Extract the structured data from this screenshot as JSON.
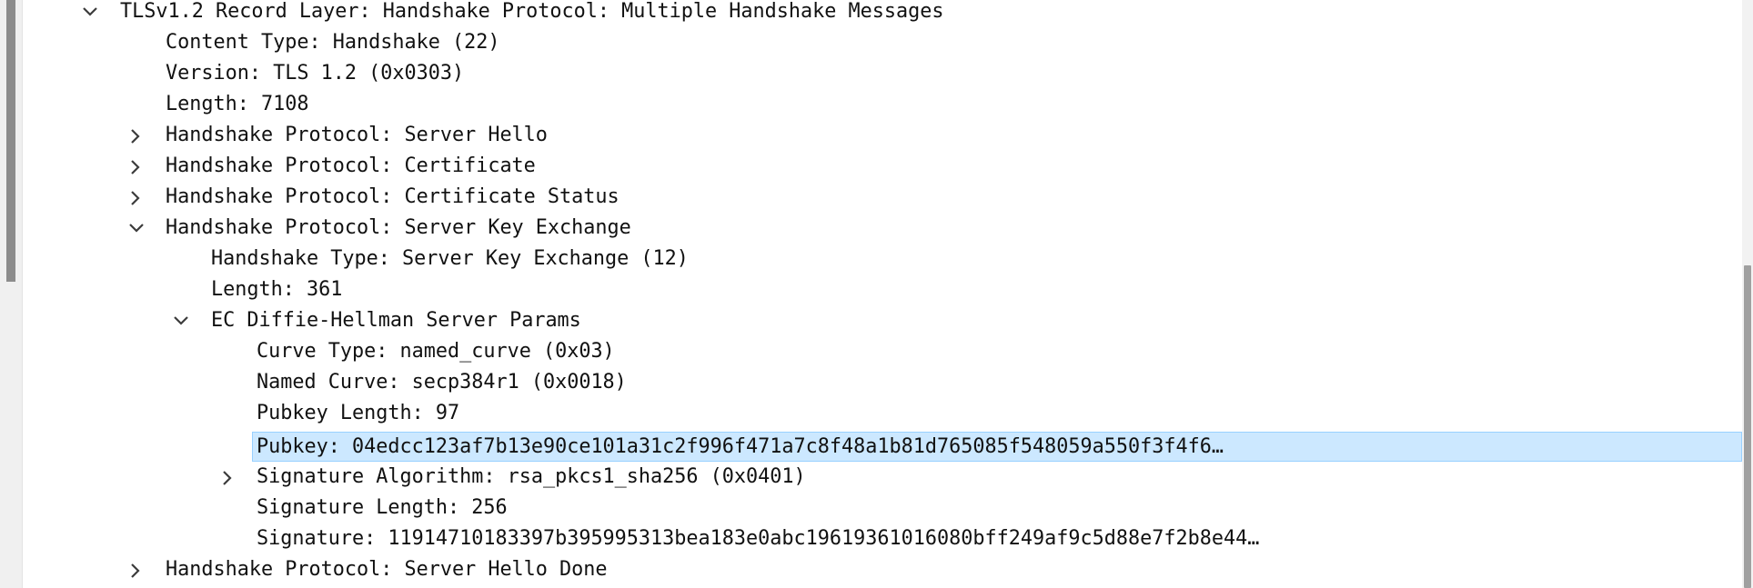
{
  "tree": {
    "rows": [
      {
        "label": "TLSv1.2 Record Layer: Handshake Protocol: Multiple Handshake Messages",
        "expander": "expanded"
      },
      {
        "label": "Content Type: Handshake (22)",
        "expander": "none"
      },
      {
        "label": "Version: TLS 1.2 (0x0303)",
        "expander": "none"
      },
      {
        "label": "Length: 7108",
        "expander": "none"
      },
      {
        "label": "Handshake Protocol: Server Hello",
        "expander": "collapsed"
      },
      {
        "label": "Handshake Protocol: Certificate",
        "expander": "collapsed"
      },
      {
        "label": "Handshake Protocol: Certificate Status",
        "expander": "collapsed"
      },
      {
        "label": "Handshake Protocol: Server Key Exchange",
        "expander": "expanded"
      },
      {
        "label": "Handshake Type: Server Key Exchange (12)",
        "expander": "none"
      },
      {
        "label": "Length: 361",
        "expander": "none"
      },
      {
        "label": "EC Diffie-Hellman Server Params",
        "expander": "expanded"
      },
      {
        "label": "Curve Type: named_curve (0x03)",
        "expander": "none"
      },
      {
        "label": "Named Curve: secp384r1 (0x0018)",
        "expander": "none"
      },
      {
        "label": "Pubkey Length: 97",
        "expander": "none"
      },
      {
        "label": "Pubkey: 04edcc123af7b13e90ce101a31c2f996f471a7c8f48a1b81d765085f548059a550f3f4f6…",
        "expander": "none",
        "selected": true
      },
      {
        "label": "Signature Algorithm: rsa_pkcs1_sha256 (0x0401)",
        "expander": "collapsed"
      },
      {
        "label": "Signature Length: 256",
        "expander": "none"
      },
      {
        "label": "Signature: 11914710183397b395995313bea183e0abc19619361016080bff249af9c5d88e7f2b8e44…",
        "expander": "none"
      },
      {
        "label": "Handshake Protocol: Server Hello Done",
        "expander": "collapsed"
      }
    ]
  }
}
